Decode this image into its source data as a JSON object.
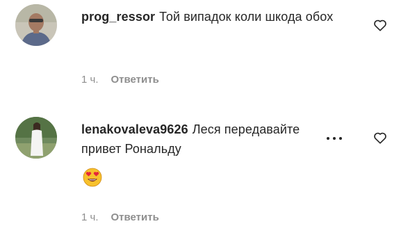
{
  "comments": [
    {
      "username": "prog_ressor",
      "text": "Той випадок коли шкода обох",
      "time": "1 ч.",
      "reply_label": "Ответить",
      "avatar_icon": "user-photo-man-sunglasses",
      "like_icon": "heart-outline-icon"
    },
    {
      "username": "lenakovaleva9626",
      "text": "Леся передавайте привет Рональду",
      "emoji": "😍",
      "time": "1 ч.",
      "reply_label": "Ответить",
      "avatar_icon": "user-photo-woman-white-dress",
      "like_icon": "heart-outline-icon",
      "more_icon": "ellipsis-icon"
    }
  ],
  "colors": {
    "text": "#262626",
    "meta": "#8e8e8e",
    "background": "#ffffff"
  }
}
